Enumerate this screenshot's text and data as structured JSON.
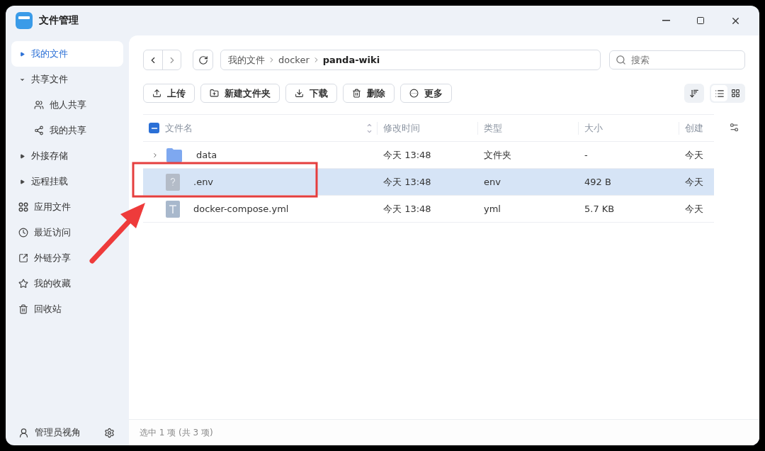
{
  "window": {
    "title": "文件管理"
  },
  "sidebar": {
    "items": [
      {
        "kind": "tree",
        "label": "我的文件",
        "expanded": false,
        "selected": true
      },
      {
        "kind": "tree",
        "label": "共享文件",
        "expanded": true,
        "selected": false,
        "children": [
          {
            "label": "他人共享",
            "selected": false
          },
          {
            "label": "我的共享",
            "selected": false
          }
        ]
      },
      {
        "kind": "tree",
        "label": "外接存储",
        "expanded": false,
        "selected": false
      },
      {
        "kind": "tree",
        "label": "远程挂载",
        "expanded": false,
        "selected": false
      },
      {
        "kind": "link",
        "label": "应用文件",
        "selected": false
      },
      {
        "kind": "link",
        "label": "最近访问",
        "selected": false
      },
      {
        "kind": "link",
        "label": "外链分享",
        "selected": false
      },
      {
        "kind": "link",
        "label": "我的收藏",
        "selected": false
      },
      {
        "kind": "link",
        "label": "回收站",
        "selected": false
      }
    ],
    "footer": {
      "label": "管理员视角"
    }
  },
  "breadcrumb": [
    "我的文件",
    "docker",
    "panda-wiki"
  ],
  "search": {
    "placeholder": "搜索"
  },
  "toolbar": [
    "上传",
    "新建文件夹",
    "下载",
    "删除",
    "更多"
  ],
  "view_modes": [
    {
      "kind": "list",
      "selected": true
    },
    {
      "kind": "grid",
      "selected": false
    }
  ],
  "table": {
    "partially_selected": true,
    "columns": [
      "文件名",
      "修改时间",
      "类型",
      "大小",
      "创建"
    ],
    "rows": [
      {
        "kind": "folder",
        "expandable": true,
        "selected": false,
        "cells": [
          "data",
          "今天 13:48",
          "文件夹",
          "-",
          "今天"
        ]
      },
      {
        "kind": "unknown",
        "expandable": false,
        "selected": true,
        "cells": [
          ".env",
          "今天 13:48",
          "env",
          "492 B",
          "今天"
        ]
      },
      {
        "kind": "text",
        "expandable": false,
        "selected": false,
        "cells": [
          "docker-compose.yml",
          "今天 13:48",
          "yml",
          "5.7 KB",
          "今天"
        ]
      }
    ]
  },
  "status_bar": "选中 1 项 (共 3 项)"
}
